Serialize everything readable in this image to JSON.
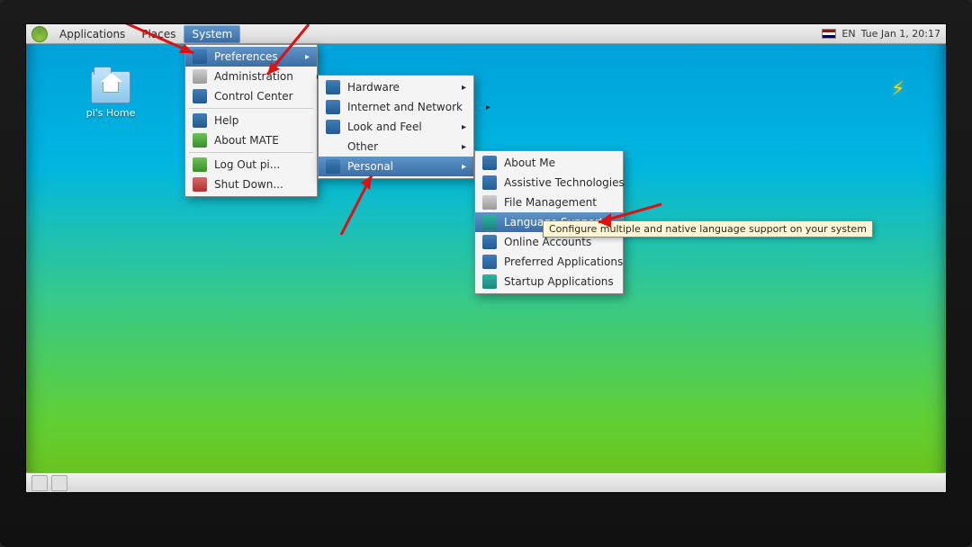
{
  "panel": {
    "menus": [
      "Applications",
      "Places",
      "System"
    ],
    "active_index": 2,
    "tray": {
      "lang": "EN",
      "clock": "Tue Jan  1, 20:17"
    }
  },
  "desktop": {
    "home_label": "pi's Home"
  },
  "menus": {
    "system": {
      "items": [
        {
          "label": "Preferences",
          "icon": "preferences-icon",
          "submenu": true,
          "selected": true
        },
        {
          "label": "Administration",
          "icon": "admin-icon",
          "submenu": true
        },
        {
          "label": "Control Center",
          "icon": "control-icon"
        }
      ],
      "items2": [
        {
          "label": "Help",
          "icon": "help-icon"
        },
        {
          "label": "About MATE",
          "icon": "about-icon"
        }
      ],
      "items3": [
        {
          "label": "Log Out pi...",
          "icon": "logout-icon"
        },
        {
          "label": "Shut Down...",
          "icon": "shutdown-icon"
        }
      ]
    },
    "prefs": {
      "items": [
        {
          "label": "Hardware",
          "icon": "hardware-icon",
          "submenu": true
        },
        {
          "label": "Internet and Network",
          "icon": "network-icon",
          "submenu": true
        },
        {
          "label": "Look and Feel",
          "icon": "lookfeel-icon",
          "submenu": true
        },
        {
          "label": "Other",
          "icon": "other-icon",
          "submenu": true
        },
        {
          "label": "Personal",
          "icon": "personal-icon",
          "submenu": true,
          "selected": true
        }
      ]
    },
    "personal": {
      "items": [
        {
          "label": "About Me",
          "icon": "aboutme-icon"
        },
        {
          "label": "Assistive Technologies",
          "icon": "assistive-icon"
        },
        {
          "label": "File Management",
          "icon": "fileman-icon"
        },
        {
          "label": "Language Support",
          "icon": "language-icon",
          "selected": true
        },
        {
          "label": "Online Accounts",
          "icon": "online-icon"
        },
        {
          "label": "Preferred Applications",
          "icon": "prefapp-icon"
        },
        {
          "label": "Startup Applications",
          "icon": "startup-icon"
        }
      ]
    }
  },
  "tooltip": "Configure multiple and native language support on your system"
}
